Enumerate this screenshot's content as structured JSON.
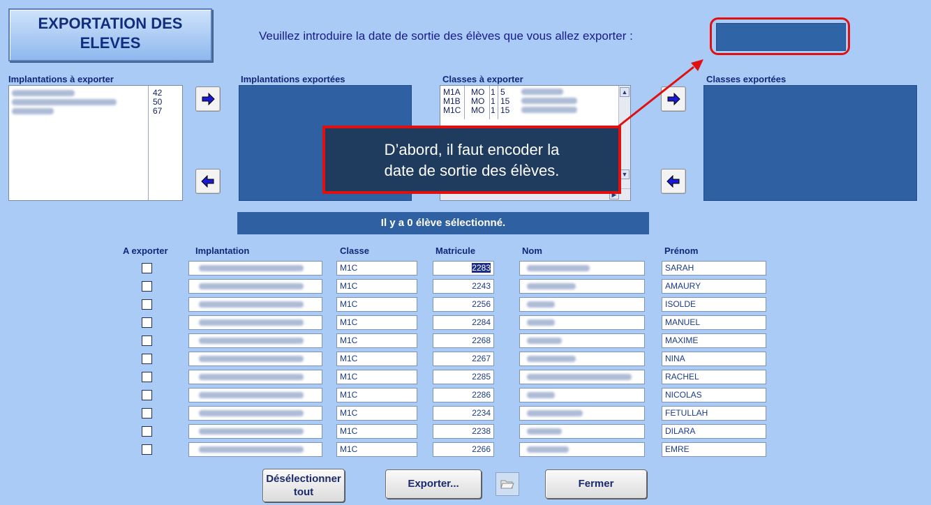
{
  "window": {
    "title_line1": "EXPORTATION DES",
    "title_line2": "ELEVES"
  },
  "prompt": {
    "text": "Veuillez introduire la date de sortie des élèves que vous allez exporter :",
    "date_value": ""
  },
  "panels": {
    "implantations_to_export": "Implantations à exporter",
    "implantations_exported": "Implantations exportées",
    "classes_to_export": "Classes à exporter",
    "classes_exported": "Classes exportées"
  },
  "implantations": [
    {
      "name": "",
      "count": "42"
    },
    {
      "name": "",
      "count": "50"
    },
    {
      "name": "",
      "count": "67"
    }
  ],
  "classes": [
    {
      "code": "M1A",
      "type": "MO",
      "level": "1",
      "num": "5"
    },
    {
      "code": "M1B",
      "type": "MO",
      "level": "1",
      "num": "15"
    },
    {
      "code": "M1C",
      "type": "MO",
      "level": "1",
      "num": "15"
    }
  ],
  "status": "Il y a 0 élève sélectionné.",
  "table": {
    "headers": {
      "export": "A exporter",
      "implantation": "Implantation",
      "classe": "Classe",
      "matricule": "Matricule",
      "nom": "Nom",
      "prenom": "Prénom"
    },
    "rows": [
      {
        "classe": "M1C",
        "matricule": "2283",
        "prenom": "SARAH"
      },
      {
        "classe": "M1C",
        "matricule": "2243",
        "prenom": "AMAURY"
      },
      {
        "classe": "M1C",
        "matricule": "2256",
        "prenom": "ISOLDE"
      },
      {
        "classe": "M1C",
        "matricule": "2284",
        "prenom": "MANUEL"
      },
      {
        "classe": "M1C",
        "matricule": "2268",
        "prenom": "MAXIME"
      },
      {
        "classe": "M1C",
        "matricule": "2267",
        "prenom": "NINA"
      },
      {
        "classe": "M1C",
        "matricule": "2285",
        "prenom": "RACHEL"
      },
      {
        "classe": "M1C",
        "matricule": "2286",
        "prenom": "NICOLAS"
      },
      {
        "classe": "M1C",
        "matricule": "2234",
        "prenom": "FETULLAH"
      },
      {
        "classe": "M1C",
        "matricule": "2238",
        "prenom": "DILARA"
      },
      {
        "classe": "M1C",
        "matricule": "2266",
        "prenom": "EMRE"
      }
    ]
  },
  "buttons": {
    "deselect_line1": "Désélectionner",
    "deselect_line2": "tout",
    "export": "Exporter...",
    "close": "Fermer"
  },
  "callout": {
    "line1": "D’abord, il faut encoder la",
    "line2": "date de sortie des élèves."
  },
  "colors": {
    "background": "#a9cbf5",
    "panel": "#2f60a2",
    "highlight": "#e01010"
  }
}
